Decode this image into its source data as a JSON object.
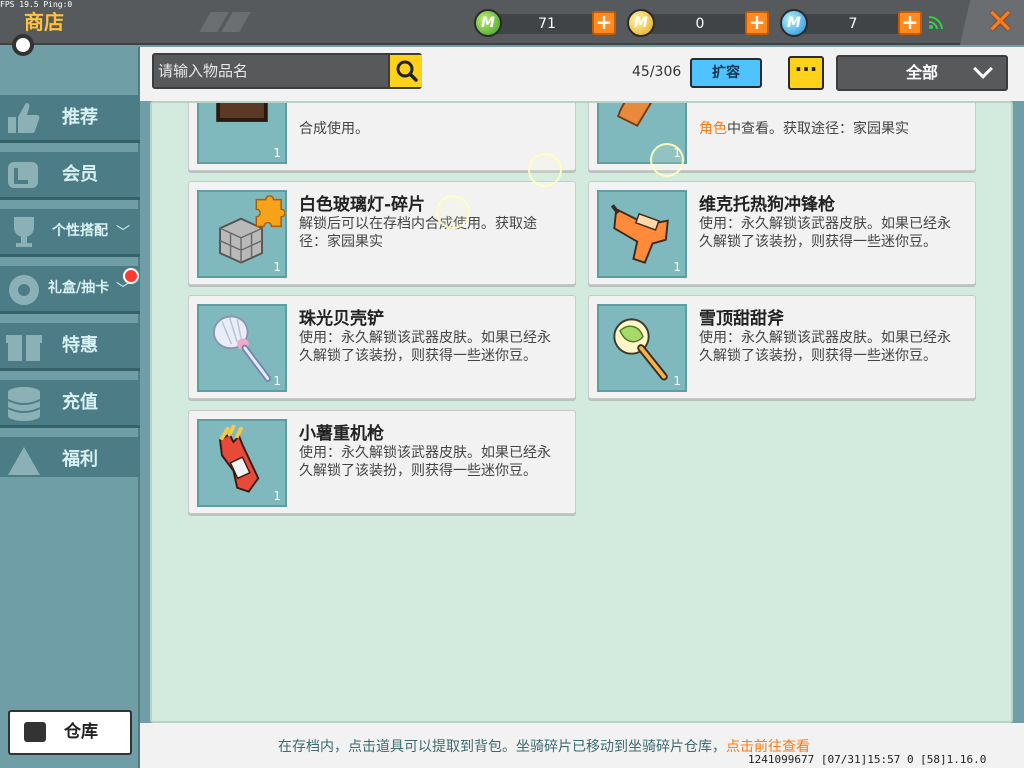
{
  "status": {
    "fps": "FPS 19.5  Ping:0"
  },
  "header": {
    "title": "商店"
  },
  "currencies": [
    {
      "name": "mini-bean",
      "icon": "green-coin-icon",
      "value": "71",
      "color": "#5cc13c"
    },
    {
      "name": "gold-coin",
      "icon": "gold-coin-icon",
      "value": "0",
      "color": "#f0b62a"
    },
    {
      "name": "mini-coin",
      "icon": "blue-coin-icon",
      "value": "7",
      "color": "#2aa3ea"
    }
  ],
  "sidebar": {
    "items": [
      {
        "label": "推荐",
        "icon": "thumbs-up-icon"
      },
      {
        "label": "会员",
        "icon": "member-card-icon"
      },
      {
        "label": "个性搭配",
        "icon": "trophy-icon",
        "chevron": "﹀"
      },
      {
        "label": "礼盒/抽卡",
        "icon": "gift-wheel-icon",
        "chevron": "﹀",
        "badge": true
      },
      {
        "label": "特惠",
        "icon": "gift-box-icon"
      },
      {
        "label": "充值",
        "icon": "coin-stack-icon"
      },
      {
        "label": "福利",
        "icon": "tent-icon"
      }
    ],
    "warehouse_label": "仓库"
  },
  "toolbar": {
    "search_placeholder": "请输入物品名",
    "count": "45/306",
    "expand_label": "扩容",
    "more_label": "···",
    "filter_label": "全部"
  },
  "items": [
    {
      "name": "",
      "desc": "合成使用。",
      "qty": "1"
    },
    {
      "name": "",
      "desc_hl": "角色",
      "desc": "中查看。获取途径：家园果实",
      "qty": "1"
    },
    {
      "name": "白色玻璃灯-碎片",
      "desc": "解锁后可以在存档内合成使用。获取途径：家园果实",
      "qty": "1"
    },
    {
      "name": "维克托热狗冲锋枪",
      "desc": "使用：永久解锁该武器皮肤。如果已经永久解锁了该装扮，则获得一些迷你豆。",
      "qty": "1"
    },
    {
      "name": "珠光贝壳铲",
      "desc": "使用：永久解锁该武器皮肤。如果已经永久解锁了该装扮，则获得一些迷你豆。",
      "qty": "1"
    },
    {
      "name": "雪顶甜甜斧",
      "desc": "使用：永久解锁该武器皮肤。如果已经永久解锁了该装扮，则获得一些迷你豆。",
      "qty": "1"
    },
    {
      "name": "小薯重机枪",
      "desc": "使用：永久解锁该武器皮肤。如果已经永久解锁了该装扮，则获得一些迷你豆。",
      "qty": "1"
    }
  ],
  "footer": {
    "message": "在存档内，点击道具可以提取到背包。坐骑碎片已移动到坐骑碎片仓库，",
    "link": "点击前往查看",
    "uid": "1241099677  [07/31]15:57 0  [58]1.16.0"
  }
}
